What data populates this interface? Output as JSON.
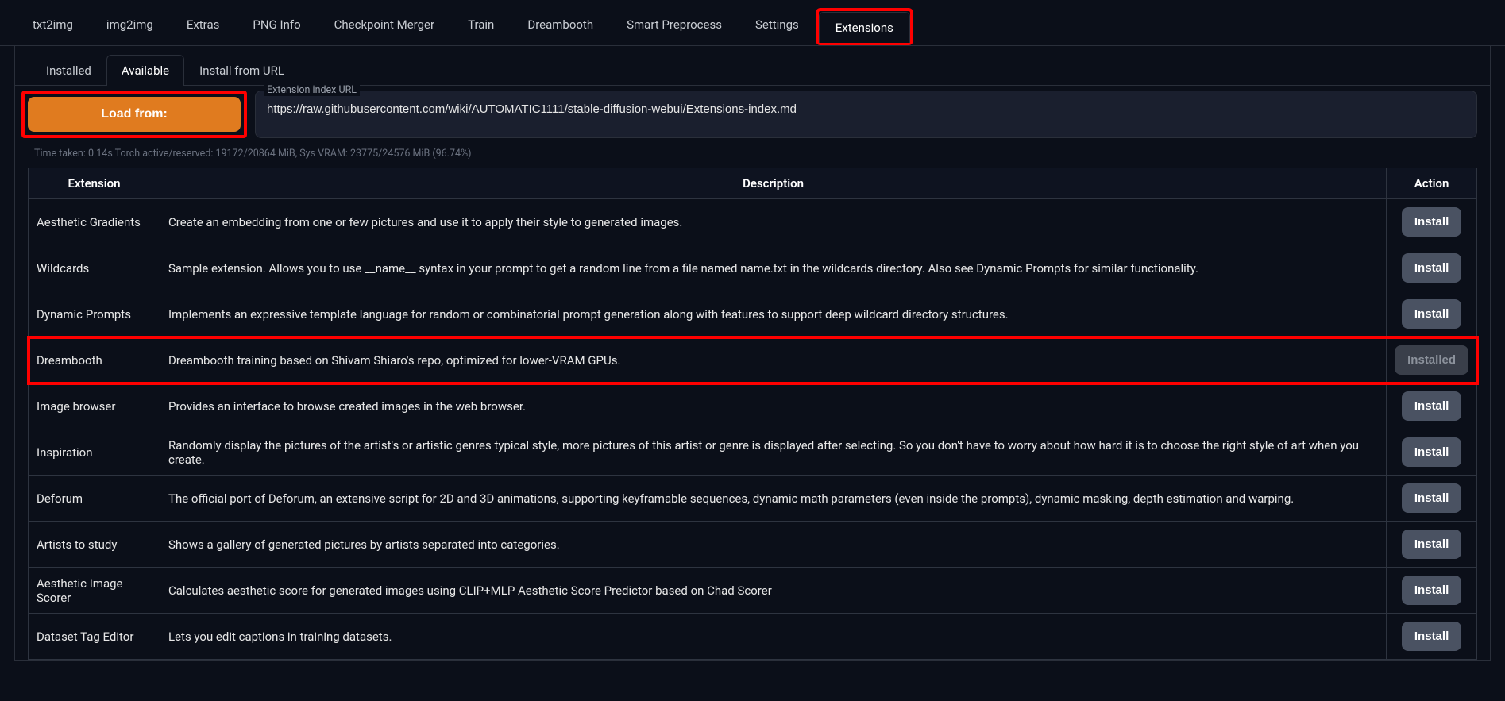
{
  "topTabs": [
    "txt2img",
    "img2img",
    "Extras",
    "PNG Info",
    "Checkpoint Merger",
    "Train",
    "Dreambooth",
    "Smart Preprocess",
    "Settings",
    "Extensions"
  ],
  "activeTopTab": "Extensions",
  "subTabs": [
    "Installed",
    "Available",
    "Install from URL"
  ],
  "activeSubTab": "Available",
  "loadBtn": "Load from:",
  "urlLabel": "Extension index URL",
  "urlValue": "https://raw.githubusercontent.com/wiki/AUTOMATIC1111/stable-diffusion-webui/Extensions-index.md",
  "statusLine": "Time taken: 0.14s  Torch active/reserved: 19172/20864 MiB, Sys VRAM: 23775/24576 MiB (96.74%)",
  "headers": {
    "ext": "Extension",
    "desc": "Description",
    "action": "Action"
  },
  "installLabel": "Install",
  "installedLabel": "Installed",
  "rows": [
    {
      "name": "Aesthetic Gradients",
      "desc": "Create an embedding from one or few pictures and use it to apply their style to generated images.",
      "installed": false,
      "highlight": false
    },
    {
      "name": "Wildcards",
      "desc": "Sample extension. Allows you to use __name__ syntax in your prompt to get a random line from a file named name.txt in the wildcards directory. Also see Dynamic Prompts for similar functionality.",
      "installed": false,
      "highlight": false
    },
    {
      "name": "Dynamic Prompts",
      "desc": "Implements an expressive template language for random or combinatorial prompt generation along with features to support deep wildcard directory structures.",
      "installed": false,
      "highlight": false
    },
    {
      "name": "Dreambooth",
      "desc": "Dreambooth training based on Shivam Shiaro's repo, optimized for lower-VRAM GPUs.",
      "installed": true,
      "highlight": true
    },
    {
      "name": "Image browser",
      "desc": "Provides an interface to browse created images in the web browser.",
      "installed": false,
      "highlight": false
    },
    {
      "name": "Inspiration",
      "desc": "Randomly display the pictures of the artist's or artistic genres typical style, more pictures of this artist or genre is displayed after selecting. So you don't have to worry about how hard it is to choose the right style of art when you create.",
      "installed": false,
      "highlight": false
    },
    {
      "name": "Deforum",
      "desc": "The official port of Deforum, an extensive script for 2D and 3D animations, supporting keyframable sequences, dynamic math parameters (even inside the prompts), dynamic masking, depth estimation and warping.",
      "installed": false,
      "highlight": false
    },
    {
      "name": "Artists to study",
      "desc": "Shows a gallery of generated pictures by artists separated into categories.",
      "installed": false,
      "highlight": false
    },
    {
      "name": "Aesthetic Image Scorer",
      "desc": "Calculates aesthetic score for generated images using CLIP+MLP Aesthetic Score Predictor based on Chad Scorer",
      "installed": false,
      "highlight": false
    },
    {
      "name": "Dataset Tag Editor",
      "desc": "Lets you edit captions in training datasets.",
      "installed": false,
      "highlight": false
    }
  ]
}
